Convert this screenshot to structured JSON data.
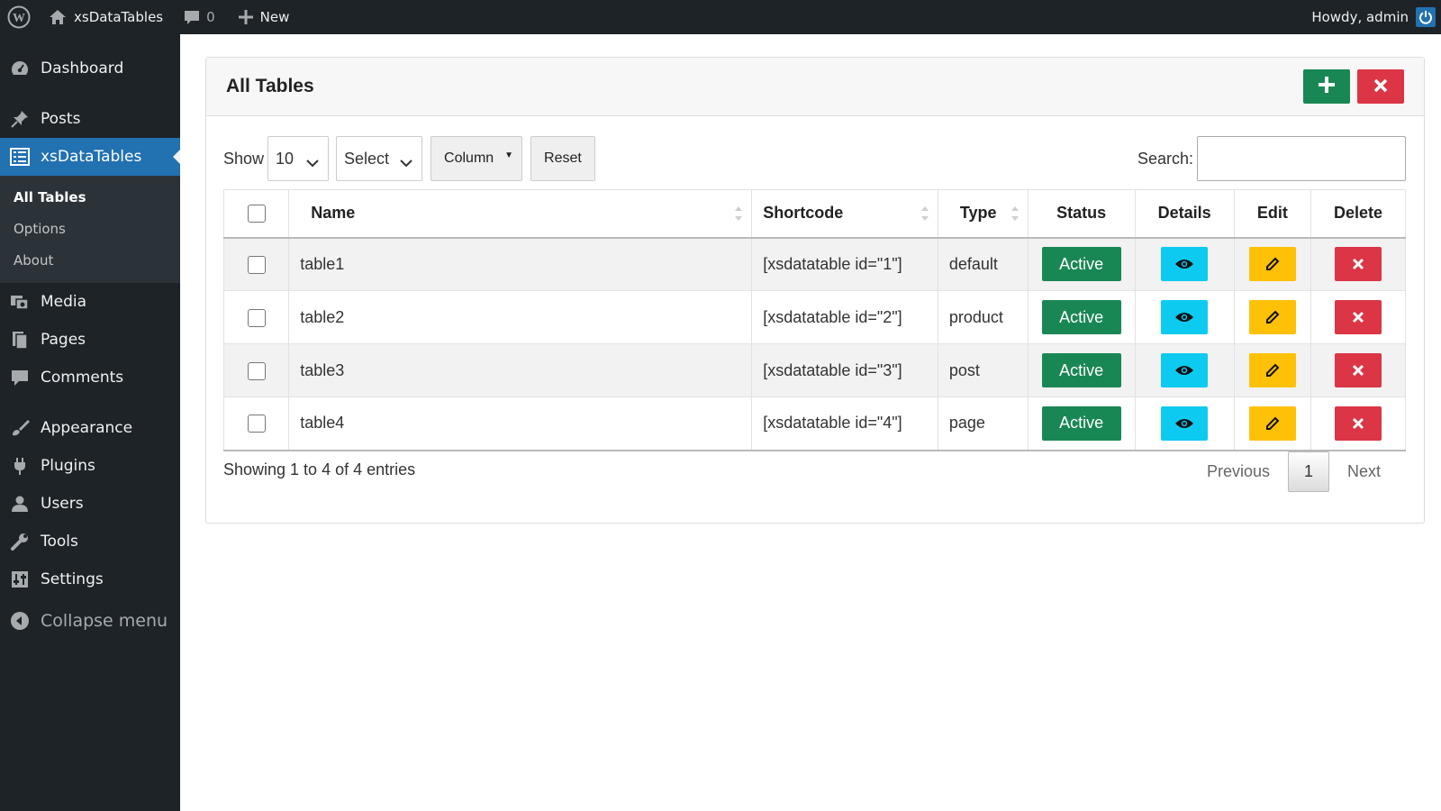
{
  "adminbar": {
    "wp_logo": "wordpress-icon",
    "site_name": "xsDataTables",
    "comments_count": "0",
    "new_label": "New",
    "howdy": "Howdy, admin"
  },
  "sidebar": {
    "items": [
      {
        "label": "Dashboard",
        "icon": "dashboard-icon"
      },
      {
        "label": "Posts",
        "icon": "pushpin-icon"
      },
      {
        "label": "xsDataTables",
        "icon": "table-icon"
      },
      {
        "label": "Media",
        "icon": "media-icon"
      },
      {
        "label": "Pages",
        "icon": "pages-icon"
      },
      {
        "label": "Comments",
        "icon": "comment-icon"
      },
      {
        "label": "Appearance",
        "icon": "brush-icon"
      },
      {
        "label": "Plugins",
        "icon": "plugin-icon"
      },
      {
        "label": "Users",
        "icon": "user-icon"
      },
      {
        "label": "Tools",
        "icon": "wrench-icon"
      },
      {
        "label": "Settings",
        "icon": "settings-icon"
      }
    ],
    "submenu": [
      "All Tables",
      "Options",
      "About"
    ],
    "collapse": "Collapse menu"
  },
  "card": {
    "title": "All Tables",
    "add_icon": "plus-icon",
    "delete_icon": "close-icon"
  },
  "controls": {
    "show_label": "Show",
    "page_size": "10",
    "select_label": "Select",
    "column_label": "Column",
    "reset_label": "Reset",
    "search_label": "Search:"
  },
  "table": {
    "columns": [
      "Name",
      "Shortcode",
      "Type",
      "Status",
      "Details",
      "Edit",
      "Delete"
    ],
    "rows": [
      {
        "name": "table1",
        "shortcode": "[xsdatatable id=\"1\"]",
        "type": "default",
        "status": "Active"
      },
      {
        "name": "table2",
        "shortcode": "[xsdatatable id=\"2\"]",
        "type": "product",
        "status": "Active"
      },
      {
        "name": "table3",
        "shortcode": "[xsdatatable id=\"3\"]",
        "type": "post",
        "status": "Active"
      },
      {
        "name": "table4",
        "shortcode": "[xsdatatable id=\"4\"]",
        "type": "page",
        "status": "Active"
      }
    ]
  },
  "footer": {
    "info": "Showing 1 to 4 of 4 entries",
    "previous": "Previous",
    "current_page": "1",
    "next": "Next"
  },
  "colors": {
    "adminbar": "#1d2327",
    "accent": "#2271b1",
    "success": "#198754",
    "danger": "#dc3545",
    "info": "#0dcaf0",
    "warning": "#ffc107"
  }
}
